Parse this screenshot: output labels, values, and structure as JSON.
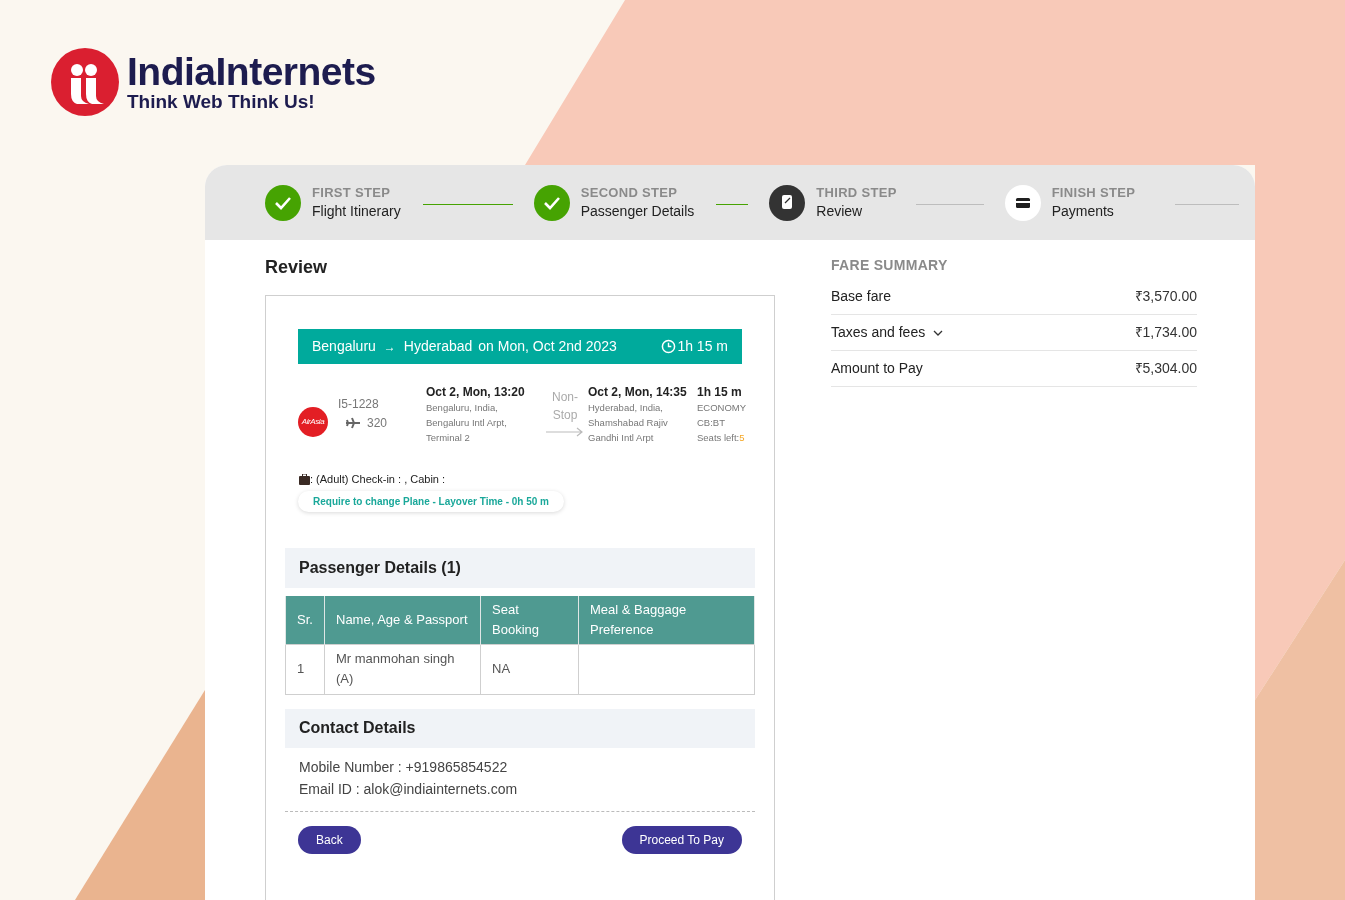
{
  "brand": {
    "name": "IndiaInternets",
    "tagline": "Think Web Think Us!"
  },
  "steps": [
    {
      "caption": "FIRST STEP",
      "label": "Flight Itinerary",
      "completed": true,
      "active": false
    },
    {
      "caption": "SECOND STEP",
      "label": "Passenger Details",
      "completed": true,
      "active": false
    },
    {
      "caption": "THIRD STEP",
      "label": "Review",
      "completed": false,
      "active": true
    },
    {
      "caption": "FINISH STEP",
      "label": "Payments",
      "completed": false,
      "active": false
    }
  ],
  "review": {
    "title": "Review",
    "route_bar": {
      "from": "Bengaluru",
      "arrow": "→",
      "to": "Hyderabad",
      "date": "on Mon, Oct 2nd 2023",
      "duration": "1h 15 m"
    },
    "flight": {
      "airline_logo": "AirAsia",
      "number": "I5-1228",
      "aircraft": "320",
      "depart": {
        "time": "Oct 2, Mon, 13:20",
        "lines": [
          "Bengaluru, India,",
          "Bengaluru Intl Arpt,",
          "Terminal 2"
        ]
      },
      "stop": [
        "Non-",
        "Stop"
      ],
      "arrive": {
        "time": "Oct 2, Mon, 14:35",
        "lines": [
          "Hyderabad, India,",
          "Shamshabad Rajiv",
          "Gandhi Intl Arpt"
        ]
      },
      "duration": "1h 15 m",
      "cabin": "ECONOMY",
      "class": "CB:BT",
      "seats_label": "Seats left:",
      "seats": "5"
    },
    "baggage": ": (Adult) Check-in : , Cabin :",
    "layover": "Require to change Plane - Layover Time - 0h 50 m",
    "passengers": {
      "title": "Passenger Details (1)",
      "columns": [
        "Sr.",
        "Name, Age & Passport",
        "Seat Booking",
        "Meal & Baggage Preference"
      ],
      "rows": [
        [
          "1",
          "Mr manmohan singh (A)",
          "NA",
          ""
        ]
      ]
    },
    "contact": {
      "title": "Contact Details",
      "lines": [
        "Mobile Number : +919865854522",
        "Email ID : alok@indiainternets.com"
      ]
    },
    "buttons": {
      "back": "Back",
      "proceed": "Proceed To Pay"
    }
  },
  "fare": {
    "title": "FARE SUMMARY",
    "rows": [
      {
        "label": "Base fare",
        "value": "₹3,570.00",
        "expandable": false
      },
      {
        "label": "Taxes and fees",
        "value": "₹1,734.00",
        "expandable": true
      },
      {
        "label": "Amount to Pay",
        "value": "₹5,304.00",
        "expandable": false
      }
    ]
  }
}
